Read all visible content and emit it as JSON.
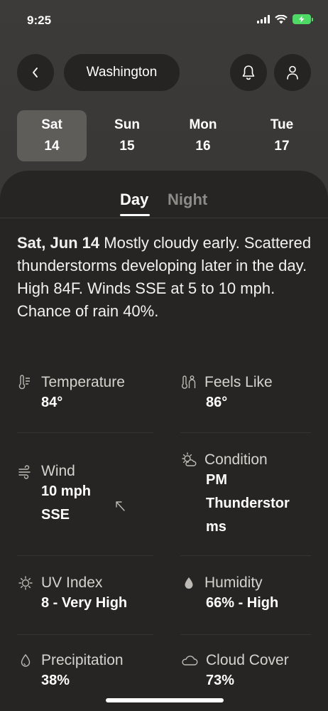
{
  "status": {
    "time": "9:25"
  },
  "nav": {
    "location": "Washington"
  },
  "days": [
    {
      "name": "Sat",
      "num": "14"
    },
    {
      "name": "Sun",
      "num": "15"
    },
    {
      "name": "Mon",
      "num": "16"
    },
    {
      "name": "Tue",
      "num": "17"
    }
  ],
  "tabs": {
    "day": "Day",
    "night": "Night"
  },
  "summary": {
    "date": "Sat, Jun 14",
    "text": " Mostly cloudy early. Scattered thunderstorms developing later in the day. High 84F. Winds SSE at 5 to 10 mph. Chance of rain 40%."
  },
  "details": {
    "temperature": {
      "label": "Temperature",
      "value": "84°"
    },
    "feels_like": {
      "label": "Feels Like",
      "value": "86°"
    },
    "wind": {
      "label": "Wind",
      "value1": "10 mph",
      "value2": "SSE"
    },
    "condition": {
      "label": "Condition",
      "value1": "PM",
      "value2": "Thunderstor",
      "value3": "ms"
    },
    "uv_index": {
      "label": "UV Index",
      "value": "8 - Very High"
    },
    "humidity": {
      "label": "Humidity",
      "value": "66% - High"
    },
    "precipitation": {
      "label": "Precipitation",
      "value": "38%"
    },
    "cloud_cover": {
      "label": "Cloud Cover",
      "value": "73%"
    }
  }
}
